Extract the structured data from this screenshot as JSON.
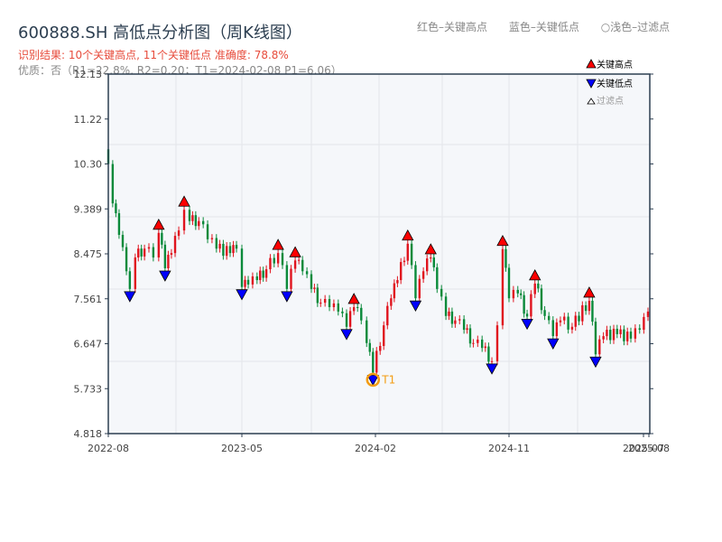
{
  "header": {
    "title": "600888.SH 高低点分析图（周K线图）",
    "result": "识别结果: 10个关键高点, 11个关键低点   准确度: 78.8%",
    "quality": "优质：否（R1=22.8%, R2=0.20；T1=2024-02-08 P1=6.06）",
    "top_legend": [
      "红色–关键高点",
      "蓝色–关键低点",
      "○浅色–过滤点"
    ]
  },
  "chart_data": {
    "type": "candlestick",
    "title": "600888.SH 高低点分析图（周K线图）",
    "ylim": [
      4.818,
      12.13
    ],
    "yticks": [
      "4.818",
      "5.733",
      "6.647",
      "7.561",
      "8.475",
      "9.389",
      "10.30",
      "11.22",
      "12.13"
    ],
    "xticks": [
      "2022-08",
      "2023-05",
      "2024-02",
      "2024-11",
      "2025-07",
      "2025-08"
    ],
    "grid": true,
    "legend_position": "top-right",
    "legend": [
      "关键高点",
      "关键低点",
      "过滤点"
    ],
    "colors": {
      "up": "#e0141e",
      "down": "#0a8a3a",
      "high_marker": "#ff0000",
      "low_marker": "#0000ff",
      "t1": "#f39c12",
      "plot_bg": "#f5f7fa"
    },
    "closes": [
      [
        "2022-08-01",
        10.3
      ],
      [
        "2022-08-10",
        9.5
      ],
      [
        "2022-08-23",
        8.86
      ],
      [
        "2022-09-07",
        8.12
      ],
      [
        "2022-09-14",
        7.76
      ],
      [
        "2022-09-25",
        8.4
      ],
      [
        "2022-10-14",
        8.58
      ],
      [
        "2022-11-01",
        8.4
      ],
      [
        "2022-11-12",
        8.9
      ],
      [
        "2022-11-25",
        8.18
      ],
      [
        "2022-12-08",
        8.49
      ],
      [
        "2022-12-23",
        8.95
      ],
      [
        "2023-01-03",
        9.37
      ],
      [
        "2023-01-14",
        9.14
      ],
      [
        "2023-02-02",
        9.14
      ],
      [
        "2023-02-20",
        8.77
      ],
      [
        "2023-03-10",
        8.58
      ],
      [
        "2023-04-07",
        8.49
      ],
      [
        "2023-04-20",
        8.58
      ],
      [
        "2023-05-01",
        7.8
      ],
      [
        "2023-05-14",
        7.85
      ],
      [
        "2023-06-01",
        7.94
      ],
      [
        "2023-06-20",
        8.16
      ],
      [
        "2023-07-14",
        8.49
      ],
      [
        "2023-08-01",
        7.76
      ],
      [
        "2023-08-18",
        8.34
      ],
      [
        "2023-09-02",
        8.12
      ],
      [
        "2023-09-20",
        7.76
      ],
      [
        "2023-10-09",
        7.48
      ],
      [
        "2023-10-27",
        7.39
      ],
      [
        "2023-11-14",
        7.3
      ],
      [
        "2023-12-01",
        6.99
      ],
      [
        "2023-12-16",
        7.39
      ],
      [
        "2023-12-31",
        7.12
      ],
      [
        "2024-01-11",
        6.66
      ],
      [
        "2024-01-24",
        6.06
      ],
      [
        "2024-02-15",
        7.02
      ],
      [
        "2024-03-01",
        7.57
      ],
      [
        "2024-03-14",
        7.94
      ],
      [
        "2024-04-04",
        8.68
      ],
      [
        "2024-04-20",
        7.57
      ],
      [
        "2024-05-06",
        8.12
      ],
      [
        "2024-05-21",
        8.4
      ],
      [
        "2024-06-03",
        7.76
      ],
      [
        "2024-06-21",
        7.21
      ],
      [
        "2024-07-10",
        7.12
      ],
      [
        "2024-07-28",
        6.93
      ],
      [
        "2024-08-16",
        6.66
      ],
      [
        "2024-09-03",
        6.56
      ],
      [
        "2024-09-23",
        6.29
      ],
      [
        "2024-10-04",
        7.02
      ],
      [
        "2024-10-15",
        8.57
      ],
      [
        "2024-10-28",
        7.57
      ],
      [
        "2024-11-15",
        7.67
      ],
      [
        "2024-12-04",
        7.2
      ],
      [
        "2024-12-20",
        7.87
      ],
      [
        "2025-01-09",
        7.21
      ],
      [
        "2025-01-26",
        6.8
      ],
      [
        "2025-02-10",
        7.12
      ],
      [
        "2025-03-06",
        6.99
      ],
      [
        "2025-04-10",
        7.52
      ],
      [
        "2025-04-23",
        6.43
      ],
      [
        "2025-05-09",
        6.8
      ],
      [
        "2025-06-06",
        6.84
      ],
      [
        "2025-07-04",
        6.75
      ],
      [
        "2025-07-22",
        6.93
      ],
      [
        "2025-08-09",
        7.21
      ],
      [
        "2025-08-27",
        7.3
      ]
    ],
    "key_highs": [
      [
        "2022-11-12",
        8.9
      ],
      [
        "2023-01-03",
        9.37
      ],
      [
        "2023-07-14",
        8.49
      ],
      [
        "2023-08-18",
        8.34
      ],
      [
        "2023-12-16",
        7.39
      ],
      [
        "2024-04-04",
        8.68
      ],
      [
        "2024-05-21",
        8.4
      ],
      [
        "2024-10-15",
        8.57
      ],
      [
        "2024-12-20",
        7.87
      ],
      [
        "2025-04-10",
        7.52
      ]
    ],
    "key_lows": [
      [
        "2022-09-14",
        7.76
      ],
      [
        "2022-11-25",
        8.18
      ],
      [
        "2023-05-01",
        7.8
      ],
      [
        "2023-08-01",
        7.76
      ],
      [
        "2023-12-01",
        6.99
      ],
      [
        "2024-01-24",
        6.06
      ],
      [
        "2024-04-20",
        7.57
      ],
      [
        "2024-09-23",
        6.29
      ],
      [
        "2024-12-04",
        7.2
      ],
      [
        "2025-01-26",
        6.8
      ],
      [
        "2025-04-23",
        6.43
      ]
    ],
    "t1": {
      "label": "T1",
      "date": "2024-01-24",
      "price": 6.06
    }
  }
}
